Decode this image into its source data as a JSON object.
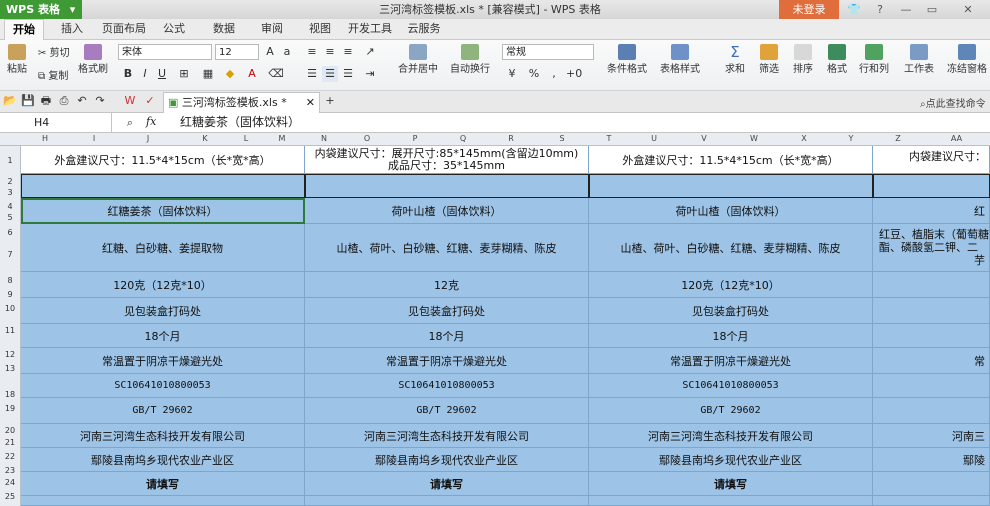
{
  "app": {
    "name": "WPS 表格",
    "doc_title": "三河湾标签模板.xls * [兼容模式] - WPS 表格",
    "login": "未登录"
  },
  "menu": [
    "开始",
    "插入",
    "页面布局",
    "公式",
    "数据",
    "审阅",
    "视图",
    "开发工具",
    "云服务"
  ],
  "ribbon": {
    "paste": "粘贴",
    "cut": "剪切",
    "copy": "复制",
    "format_painter": "格式刷",
    "font_name": "宋体",
    "font_size": "12",
    "number_format": "常规",
    "merge": "合并居中",
    "wrap": "自动换行",
    "percent": "%",
    "cond_format": "条件格式",
    "table_style": "表格样式",
    "sum": "求和",
    "filter": "筛选",
    "sort": "排序",
    "format": "格式",
    "rowcol": "行和列",
    "sheet": "工作表",
    "freeze": "冻结窗格",
    "search_hint": "点此查找命令"
  },
  "doc_tab": "三河湾标签模板.xls *",
  "name_box": "H4",
  "fx": "fx",
  "formula_value": "红糖姜茶（固体饮料）",
  "columns": [
    "H",
    "I",
    "J",
    "K",
    "L",
    "M",
    "N",
    "O",
    "P",
    "Q",
    "R",
    "S",
    "T",
    "U",
    "V",
    "W",
    "X",
    "Y",
    "Z",
    "AA"
  ],
  "rows": [
    "1",
    "2",
    "3",
    "4",
    "5",
    "6",
    "7",
    "8",
    "9",
    "10",
    "11",
    "12",
    "13",
    "18",
    "19",
    "20",
    "21",
    "22",
    "23",
    "24",
    "25"
  ],
  "sheet": {
    "r1": [
      "外盒建议尺寸：11.5*4*15cm（长*宽*高）",
      "内袋建议尺寸：展开尺寸:85*145mm(含留边10mm)",
      "成品尺寸：35*145mm",
      "外盒建议尺寸：11.5*4*15cm（长*宽*高）",
      "内袋建议尺寸："
    ],
    "name": [
      "红糖姜茶（固体饮料）",
      "荷叶山楂（固体饮料）",
      "荷叶山楂（固体饮料）",
      "红"
    ],
    "ingredients": [
      "红糖、白砂糖、姜提取物",
      "山楂、荷叶、白砂糖、红糖、麦芽糊精、陈皮",
      "山楂、荷叶、白砂糖、红糖、麦芽糊精、陈皮",
      "红豆、植脂末（葡萄糖",
      "酯、磷酸氢二钾、二",
      "芋"
    ],
    "weight": [
      "120克（12克*10）",
      "12克",
      "120克（12克*10）"
    ],
    "code_place": [
      "见包装盒打码处",
      "见包装盒打码处",
      "见包装盒打码处"
    ],
    "shelf": [
      "18个月",
      "18个月",
      "18个月"
    ],
    "storage": [
      "常温置于阴凉干燥避光处",
      "常温置于阴凉干燥避光处",
      "常温置于阴凉干燥避光处",
      "常"
    ],
    "license": [
      "SC10641010800053",
      "SC10641010800053",
      "SC10641010800053"
    ],
    "standard": [
      "GB/T 29602",
      "GB/T 29602",
      "GB/T 29602"
    ],
    "company": [
      "河南三河湾生态科技开发有限公司",
      "河南三河湾生态科技开发有限公司",
      "河南三河湾生态科技开发有限公司",
      "河南三"
    ],
    "address": [
      "鄢陵县南坞乡现代农业产业区",
      "鄢陵县南坞乡现代农业产业区",
      "鄢陵县南坞乡现代农业产业区",
      "鄢陵"
    ],
    "fill": [
      "请填写",
      "请填写",
      "请填写"
    ]
  }
}
